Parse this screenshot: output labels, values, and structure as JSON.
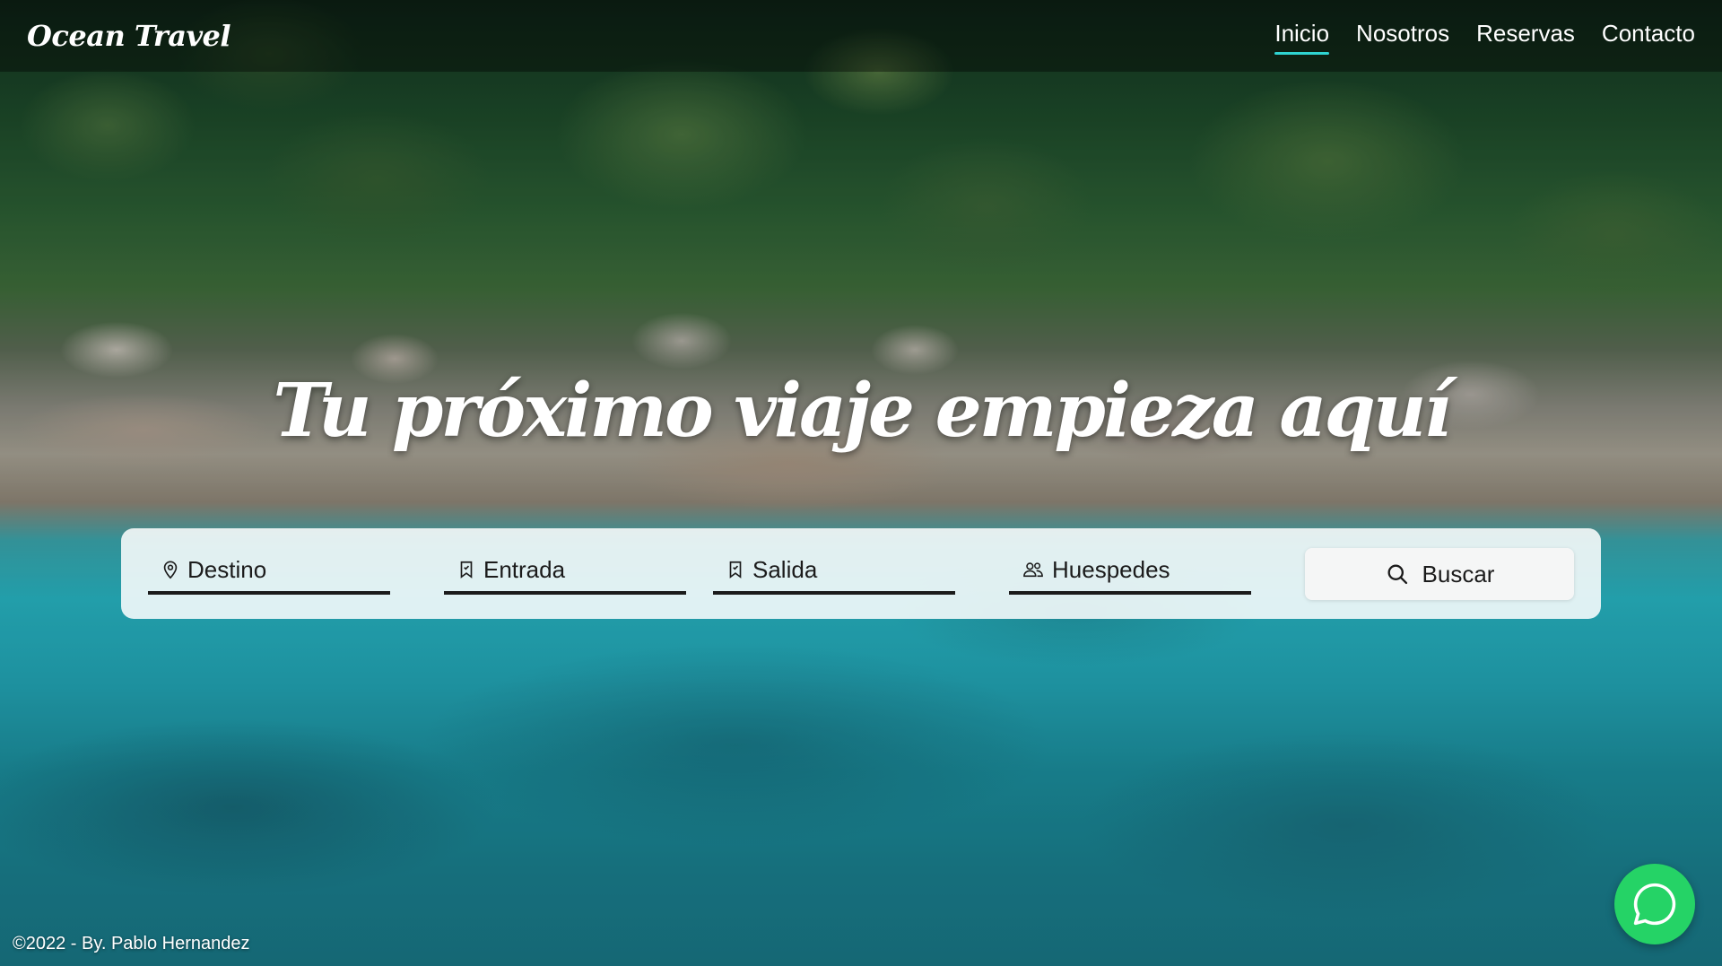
{
  "header": {
    "brand": "Ocean Travel",
    "nav": [
      {
        "label": "Inicio",
        "active": true
      },
      {
        "label": "Nosotros",
        "active": false
      },
      {
        "label": "Reservas",
        "active": false
      },
      {
        "label": "Contacto",
        "active": false
      }
    ],
    "accent_color": "#2fd4d2"
  },
  "hero": {
    "title": "Tu próximo viaje empieza aquí"
  },
  "search": {
    "fields": [
      {
        "icon": "map-pin-icon",
        "label": "Destino"
      },
      {
        "icon": "bookmark-icon",
        "label": "Entrada"
      },
      {
        "icon": "bookmark-icon",
        "label": "Salida"
      },
      {
        "icon": "users-icon",
        "label": "Huespedes"
      }
    ],
    "button": {
      "icon": "search-icon",
      "label": "Buscar"
    }
  },
  "footer": {
    "credit": "©2022 - By. Pablo Hernandez"
  },
  "chat": {
    "icon": "whatsapp-icon",
    "color": "#25d366"
  }
}
